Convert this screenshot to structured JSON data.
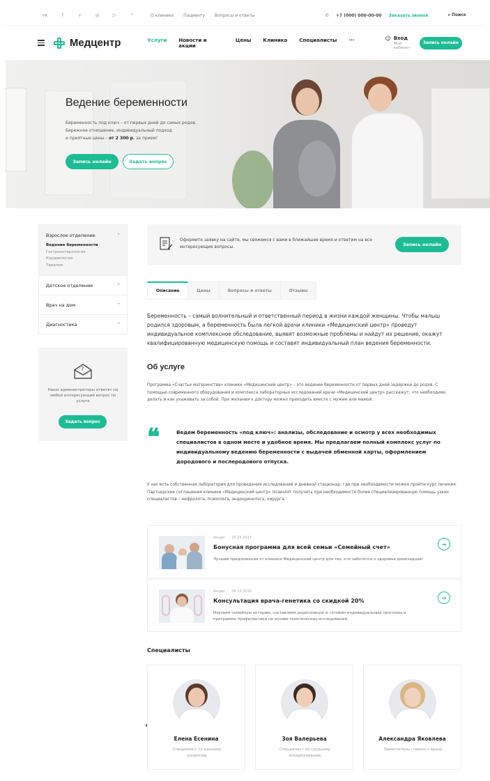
{
  "topbar": {
    "social_icons": [
      "vk-icon",
      "facebook-icon",
      "twitter-icon",
      "instagram-icon",
      "youtube-icon",
      "odnoklassniki-icon"
    ],
    "social_glyphs": [
      "ᴠᴋ",
      "f",
      "ʏ",
      "◎",
      "▷",
      "ᴷ"
    ],
    "links": [
      "О клинике",
      "Пациенту",
      "Вопросы и ответы"
    ],
    "phone": "+7 (000) 000-00-00",
    "callback": "Заказать звонок",
    "search": "Поиск"
  },
  "header": {
    "logo": "Медцентр",
    "nav": [
      "Услуги",
      "Новости и акции",
      "Цены",
      "Клиника",
      "Специалисты",
      "···"
    ],
    "login_label": "Вход",
    "login_sub": "Мой кабинет",
    "cta": "Запись онлайн"
  },
  "hero": {
    "title": "Ведение беременности",
    "line1": "Беременность под ключ – от первых дней до самых родов.",
    "line2": "Бережное отношение, индивидуальный подход",
    "line3_prefix": "и приятные цены – ",
    "line3_price": "от 2 300 р.",
    "line3_suffix": " за прием!",
    "btn_primary": "Запись онлайн",
    "btn_secondary": "Задать вопрос"
  },
  "sidebar": {
    "open_section": "Взрослое отделение",
    "sub_items": [
      "Ведение беременности",
      "Гастроэнтерология",
      "Кардиология",
      "Терапия"
    ],
    "sections": [
      "Детское отделение",
      "Врач на дом",
      "Диагностика"
    ],
    "box_text": "Наши администраторы ответят на любой интересующий вопрос по услуге",
    "box_button": "Задать вопрос"
  },
  "callbox": {
    "text": "Оформите заявку на сайте, мы свяжемся с вами в ближайшее время и ответим на все интересующие вопросы.",
    "button": "Запись онлайн"
  },
  "tabs": [
    "Описание",
    "Цены",
    "Вопросы и ответы",
    "Отзывы"
  ],
  "content": {
    "lead": "Беременность – самый волнительный и ответственный период в жизни каждой женщины. Чтобы малыш родился здоровым, а беременность была легкой врачи клиники «Медицинский центр» проведут индивидуальное комплексное обследование, выявят возможные проблемы и найдут их решение, окажут квалифицированную медицинскую помощь и составят индивидуальный план ведения беременности.",
    "about_title": "Об услуге",
    "about_text": "Программа «Счастье материнства» клиники «Медицинский центр» – это ведение беременности от первых дней задержки до родов. С помощью современного оборудования и комплекса лабораторных исследований врачи «Медицинский центр» расскажут, что необходимо делать и как ухаживать за собой. При желании к доктору можно приходить вместе с мужем или мамой.",
    "quote": "Ведем беременность «под ключ»: анализы, обследование и осмотр у всех необходимых специалистов в одном месте и удобное время. Мы предлагаем полный комплекс услуг по индивидуальному ведению беременности с выдачей обменной карты, оформлением дородового и послеродового отпуска.",
    "lab_text": "У нас есть собственная лаборатория для проведения исследований и дневной стационар, где при необходимости можно пройти курс лечения. Партнерские соглашения клиники «Медицинский центр» позволят получить при необходимости более специализированную помощь узких специалистов – нефролога, психолога, эндокринолога, хирурга."
  },
  "promos": [
    {
      "tag": "Акции",
      "date": "25.05.2017",
      "title": "Бонусная программа для всей семьи «Семейный счет»",
      "desc": "Лучшие предложения от клиники Медицинский центр для тех, кто заботится о здоровье домочадцев!"
    },
    {
      "tag": "Акции",
      "date": "06.10.2016",
      "title": "Консультация врача-генетика со скидкой 20%",
      "desc": "Изучаем семейную историю, составляем родословную и готовим индивидуальные прогнозы и программы профилактики на основе генетических исследований."
    }
  ],
  "specialists": {
    "title": "Специалисты",
    "items": [
      {
        "name": "Елена Есенина",
        "role": "Специалист по раннему развитию"
      },
      {
        "name": "Зоя Валерьева",
        "role": "Специалист по грудному вскармливанию"
      },
      {
        "name": "Александра Яковлева",
        "role": "Заместитель главного врача"
      }
    ]
  },
  "colors": {
    "accent": "#1ebc94",
    "text": "#222222",
    "muted": "#888888",
    "panel": "#f4f4f4"
  }
}
